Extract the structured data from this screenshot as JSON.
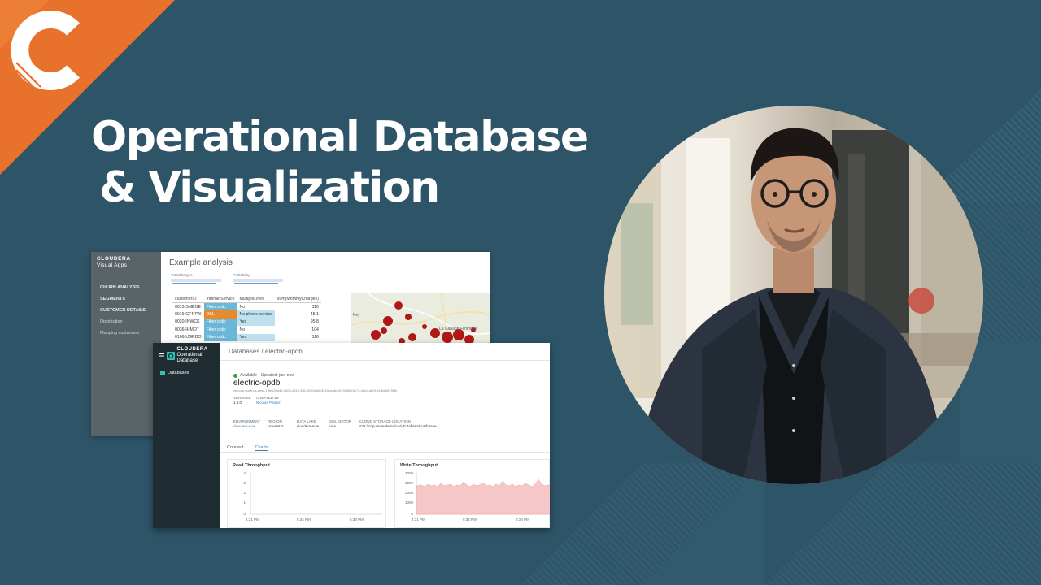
{
  "headline": {
    "line1": "Operational Database",
    "line2": "& Visualization"
  },
  "brand": {
    "accent": "#e8722c",
    "background": "#2d5467",
    "logo_icon": "cloudera-c-logo"
  },
  "visual_apps": {
    "brand_line1": "CLOUDERA",
    "brand_line2": "Visual Apps",
    "nav": {
      "churn_analysis": "CHURN ANALYSIS",
      "segments": "SEGMENTS",
      "customer_details": "CUSTOMER DETAILS",
      "distribution": "Distribution",
      "mapping_customers": "Mapping customers"
    },
    "title": "Example analysis",
    "slider1_label": "TotalCharges",
    "slider2_label": "Probability",
    "table": {
      "headers": [
        "customerID",
        "InternetService",
        "MultipleLines",
        "sum(MonthlyCharges)"
      ],
      "rows": [
        [
          "0013-SMEOE",
          "Fiber optic",
          "No",
          "110"
        ],
        [
          "0019-GFNTW",
          "DSL",
          "No phone service",
          "45.1"
        ],
        [
          "0020-INWCK",
          "Fiber optic",
          "Yes",
          "95.8"
        ],
        [
          "0036-IHMOT",
          "Fiber optic",
          "No",
          "104"
        ],
        [
          "0106-UGRDO",
          "Fiber optic",
          "Yes",
          "116"
        ]
      ]
    },
    "map_labels": {
      "place1": "Key",
      "place2": "La Cañada Flintridge"
    }
  },
  "operational_db": {
    "brand_line1": "CLOUDERA",
    "brand_line2": "Operational Database",
    "nav_databases": "Databases",
    "breadcrumb": "Databases / electric-opdb",
    "status": "Available · Updated: just now",
    "db_name": "electric-opdb",
    "crn": "crn:cdp:opdb:us-west-1:5e13ha41-0605-4518-9d1-89524a6c3e18:opdb:30190888:6c73-4ebd-af29:31dba6870f8b",
    "version_label": "VERSION",
    "version_value": "1.9.0",
    "created_by_label": "CREATED BY",
    "created_by_value": "Nicolas Peláez",
    "environment_label": "ENVIRONMENT",
    "environment_value": "cloudera-now",
    "region_label": "REGION",
    "region_value": "us-west-2",
    "datalake_label": "DATA LAKE",
    "datalake_value": "cloudera-now",
    "sql_editor_label": "SQL EDITOR",
    "sql_editor_value": "Hue",
    "cloud_storage_label": "CLOUD STORAGE LOCATION",
    "cloud_storage_value": "s3a://cdp-cnow-demo/cod-7c7af/ermicus/hbase",
    "tab_connect": "Connect",
    "tab_charts": "Charts",
    "read_chart": {
      "title": "Read Throughput",
      "y_ticks": [
        "4",
        "3",
        "2",
        "1",
        "0"
      ],
      "x_ticks": [
        "4:31 PM",
        "5:34 PM",
        "5:38 PM"
      ]
    },
    "write_chart": {
      "title": "Write Throughput",
      "y_ticks": [
        "4000",
        "3000",
        "2000",
        "1000",
        "0"
      ],
      "x_ticks": [
        "4:31 PM",
        "5:34 PM",
        "5:38 PM"
      ]
    }
  }
}
